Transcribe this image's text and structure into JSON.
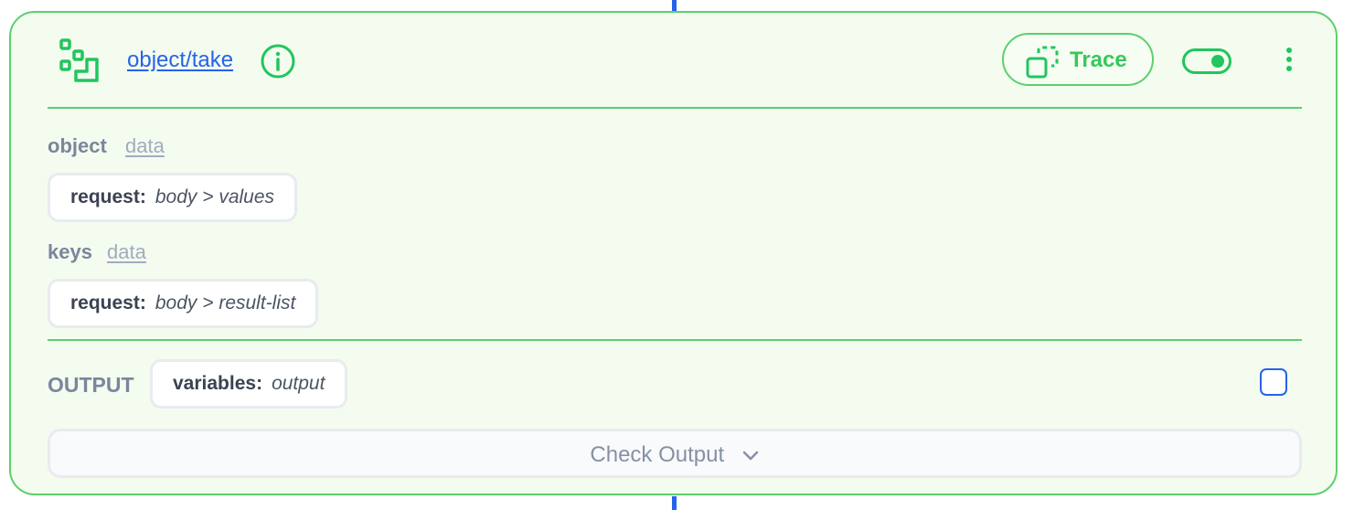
{
  "node": {
    "title": "object/take",
    "icon": "steps-node-icon",
    "accent_color": "#22c55e",
    "link_color": "#2563eb"
  },
  "header": {
    "trace_label": "Trace",
    "toggle_on": true
  },
  "params": [
    {
      "name": "object",
      "type": "data",
      "value_key": "request:",
      "value_path": "body > values"
    },
    {
      "name": "keys",
      "type": "data",
      "value_key": "request:",
      "value_path": "body > result-list"
    }
  ],
  "output": {
    "label": "OUTPUT",
    "value_key": "variables:",
    "value_path": "output",
    "checked": false
  },
  "check_output": {
    "label": "Check Output"
  }
}
